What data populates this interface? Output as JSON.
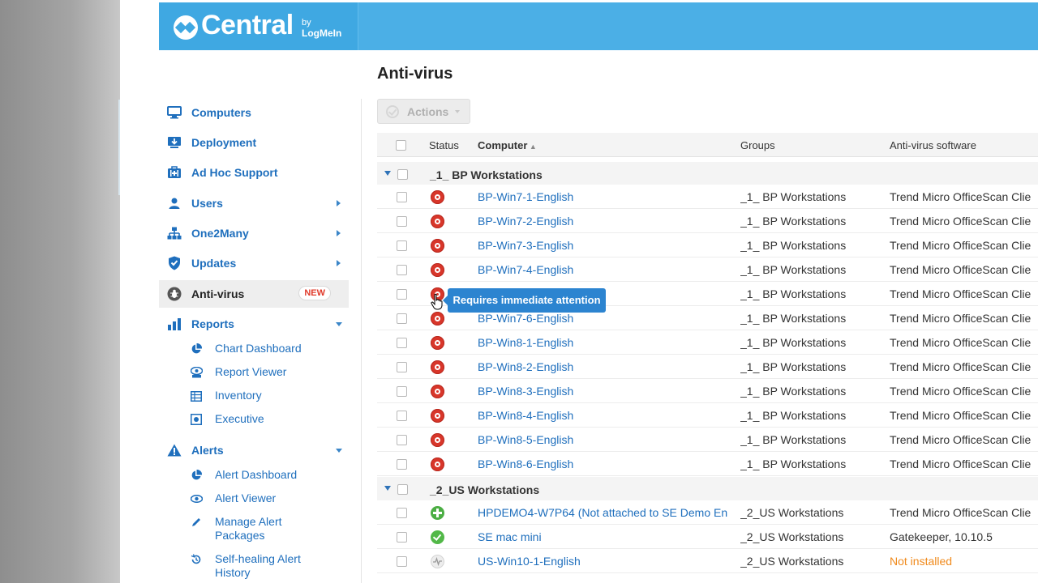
{
  "brand": {
    "name": "Central",
    "by": "by",
    "vendor": "LogMeIn",
    "color": "#4bafe6"
  },
  "page": {
    "title": "Anti-virus"
  },
  "sidebar": {
    "items": [
      {
        "label": "Computers",
        "icon": "monitor-icon"
      },
      {
        "label": "Deployment",
        "icon": "download-icon"
      },
      {
        "label": "Ad Hoc Support",
        "icon": "support-kit-icon"
      },
      {
        "label": "Users",
        "icon": "user-icon"
      },
      {
        "label": "One2Many",
        "icon": "hierarchy-icon"
      },
      {
        "label": "Updates",
        "icon": "shield-check-icon"
      },
      {
        "label": "Anti-virus",
        "icon": "bug-icon",
        "badge": "NEW"
      },
      {
        "label": "Reports",
        "icon": "bar-chart-icon"
      },
      {
        "label": "Alerts",
        "icon": "warning-icon"
      }
    ],
    "reports_sub": [
      {
        "label": "Chart Dashboard",
        "icon": "pie-chart-icon"
      },
      {
        "label": "Report Viewer",
        "icon": "report-viewer-icon"
      },
      {
        "label": "Inventory",
        "icon": "grid-table-icon"
      },
      {
        "label": "Executive",
        "icon": "executive-report-icon"
      }
    ],
    "alerts_sub": [
      {
        "label": "Alert Dashboard",
        "icon": "pie-chart-icon"
      },
      {
        "label": "Alert Viewer",
        "icon": "eye-icon"
      },
      {
        "label": "Manage Alert Packages",
        "icon": "pencil-icon"
      },
      {
        "label": "Self-healing Alert History",
        "icon": "history-icon"
      }
    ]
  },
  "toolbar": {
    "actions_label": "Actions"
  },
  "table": {
    "columns": {
      "status": "Status",
      "computer": "Computer",
      "groups": "Groups",
      "antivirus": "Anti-virus software"
    },
    "groups": [
      {
        "name": "_1_ BP Workstations",
        "rows": [
          {
            "status": "alert",
            "computer": "BP-Win7-1-English",
            "group": "_1_ BP Workstations",
            "av": "Trend Micro OfficeScan Clie"
          },
          {
            "status": "alert",
            "computer": "BP-Win7-2-English",
            "group": "_1_ BP Workstations",
            "av": "Trend Micro OfficeScan Clie"
          },
          {
            "status": "alert",
            "computer": "BP-Win7-3-English",
            "group": "_1_ BP Workstations",
            "av": "Trend Micro OfficeScan Clie"
          },
          {
            "status": "alert",
            "computer": "BP-Win7-4-English",
            "group": "_1_ BP Workstations",
            "av": "Trend Micro OfficeScan Clie"
          },
          {
            "status": "alert",
            "computer": "",
            "group": "_1_ BP Workstations",
            "av": "Trend Micro OfficeScan Clie"
          },
          {
            "status": "alert",
            "computer": "BP-Win7-6-English",
            "group": "_1_ BP Workstations",
            "av": "Trend Micro OfficeScan Clie"
          },
          {
            "status": "alert",
            "computer": "BP-Win8-1-English",
            "group": "_1_ BP Workstations",
            "av": "Trend Micro OfficeScan Clie"
          },
          {
            "status": "alert",
            "computer": "BP-Win8-2-English",
            "group": "_1_ BP Workstations",
            "av": "Trend Micro OfficeScan Clie"
          },
          {
            "status": "alert",
            "computer": "BP-Win8-3-English",
            "group": "_1_ BP Workstations",
            "av": "Trend Micro OfficeScan Clie"
          },
          {
            "status": "alert",
            "computer": "BP-Win8-4-English",
            "group": "_1_ BP Workstations",
            "av": "Trend Micro OfficeScan Clie"
          },
          {
            "status": "alert",
            "computer": "BP-Win8-5-English",
            "group": "_1_ BP Workstations",
            "av": "Trend Micro OfficeScan Clie"
          },
          {
            "status": "alert",
            "computer": "BP-Win8-6-English",
            "group": "_1_ BP Workstations",
            "av": "Trend Micro OfficeScan Clie"
          }
        ]
      },
      {
        "name": "_2_US Workstations",
        "rows": [
          {
            "status": "plus",
            "computer": "HPDEMO4-W7P64 (Not attached to SE Demo En",
            "group": "_2_US Workstations",
            "av": "Trend Micro OfficeScan Clie"
          },
          {
            "status": "ok",
            "computer": "SE mac mini",
            "group": "_2_US Workstations",
            "av": "Gatekeeper, 10.10.5"
          },
          {
            "status": "none",
            "computer": "US-Win10-1-English",
            "group": "_2_US Workstations",
            "av": "Not installed",
            "av_warn": true
          }
        ]
      }
    ]
  },
  "tooltip": {
    "text": "Requires immediate attention"
  }
}
